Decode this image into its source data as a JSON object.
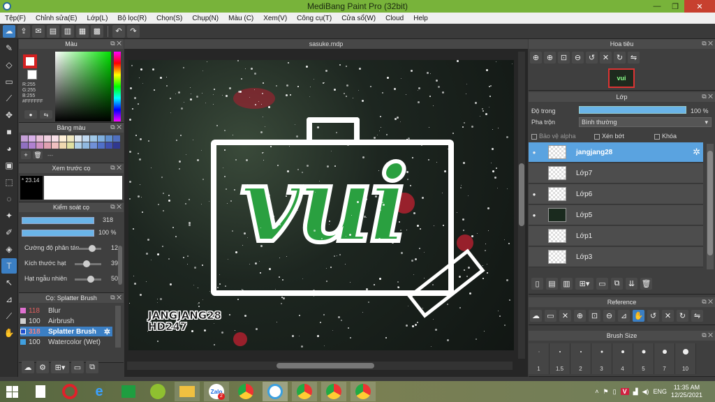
{
  "window": {
    "title": "MediBang Paint Pro (32bit)",
    "min": "—",
    "max": "❐",
    "close": "✕"
  },
  "menu": [
    "Tệp(F)",
    "Chỉnh sửa(E)",
    "Lớp(L)",
    "Bộ lọc(R)",
    "Chọn(S)",
    "Chụp(N)",
    "Màu (C)",
    "Xem(V)",
    "Công cụ(T)",
    "Cửa sổ(W)",
    "Cloud",
    "Help"
  ],
  "panels": {
    "color": "Màu",
    "palette": "Bảng màu",
    "brush_preview": "Xem trước cọ",
    "brush_control": "Kiểm soát cọ",
    "brush_list": "Cọ: Splatter Brush",
    "navigator": "Hoa tiêu",
    "layers": "Lớp",
    "reference": "Reference",
    "brush_size": "Brush Size"
  },
  "color_panel": {
    "r": "R:255",
    "g": "G:255",
    "b": "B:255",
    "hex": "#FFFFFF",
    "primary": "#ffffff",
    "accent": "#d42020"
  },
  "brush_preview_text": "* 23.14",
  "brush_control": {
    "size_value": "318",
    "opacity_value": "100 %",
    "scatter_label": "Cường độ phân tán",
    "scatter_value": "12",
    "particle_label": "Kích thước hạt",
    "particle_value": "39",
    "random_label": "Hạt ngẫu nhiên",
    "random_value": "50"
  },
  "brushes": [
    {
      "size": "118",
      "name": "Blur",
      "color": "#e070d0"
    },
    {
      "size": "100",
      "name": "Airbrush",
      "color": "#d0d0d0"
    },
    {
      "size": "318",
      "name": "Splatter Brush",
      "color": "#2050d0"
    },
    {
      "size": "100",
      "name": "Watercolor (Wet)",
      "color": "#40a0e0"
    }
  ],
  "document": {
    "filename": "sasuke.mdp",
    "watermark_line1": "JANGJANG28",
    "watermark_line2": "HD247",
    "artwork_text": "vui"
  },
  "layers_panel": {
    "opacity_label": "Độ trong",
    "opacity_value": "100 %",
    "blend_label": "Pha trộn",
    "blend_value": "Bình thường",
    "protect_alpha": "Bảo vệ alpha",
    "clipping": "Xén bớt",
    "lock": "Khóa",
    "layers": [
      {
        "name": "jangjang28",
        "active": true
      },
      {
        "name": "Lớp7",
        "active": false
      },
      {
        "name": "Lớp6",
        "active": false
      },
      {
        "name": "Lớp5",
        "active": false
      },
      {
        "name": "Lớp1",
        "active": false
      },
      {
        "name": "Lớp3",
        "active": false
      }
    ]
  },
  "brush_sizes": [
    "1",
    "1.5",
    "2",
    "3",
    "4",
    "5",
    "7",
    "10"
  ],
  "taskbar": {
    "language": "ENG",
    "time": "11:35 AM",
    "date": "12/25/2021",
    "zalo_badge": "2"
  }
}
